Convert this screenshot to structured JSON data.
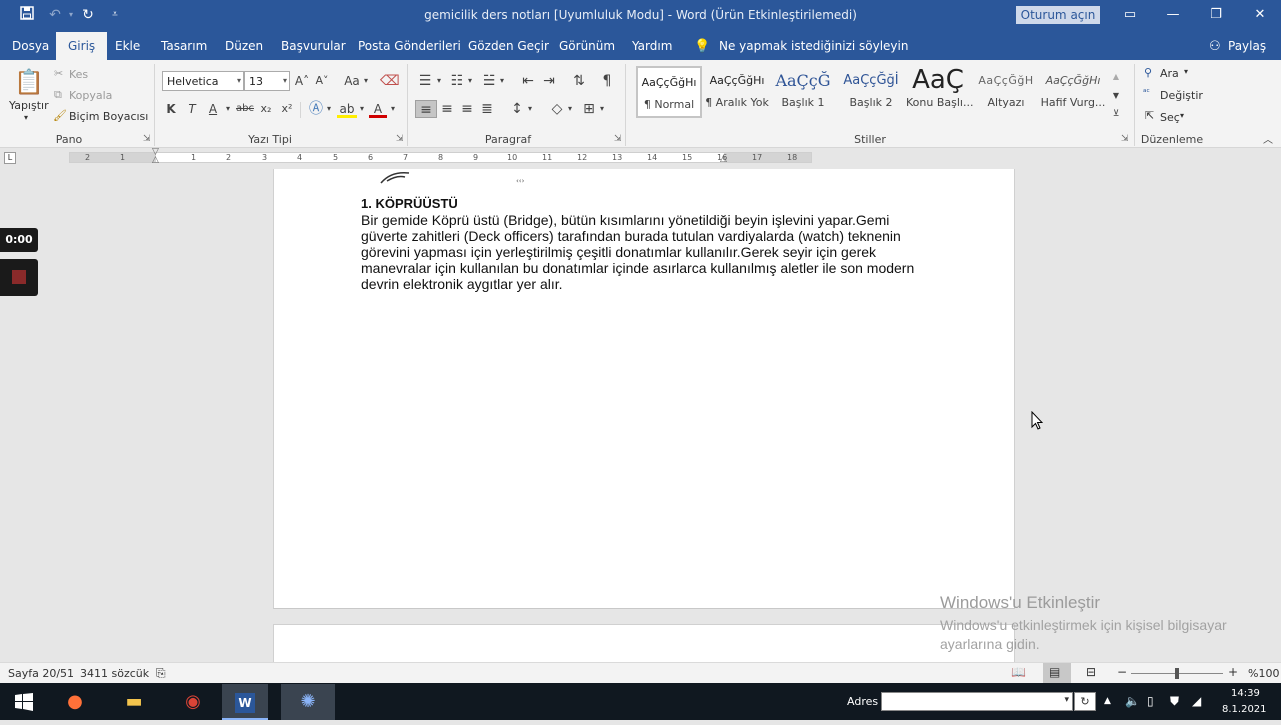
{
  "titlebar": {
    "title": "gemicilik ders notları [Uyumluluk Modu]  -  Word (Ürün Etkinleştirilemedi)",
    "signin_label": "Oturum açın",
    "save_icon": "save-icon",
    "undo_icon": "undo-icon",
    "redo_icon": "redo-icon",
    "customize_icon": "customize-quick-access-icon"
  },
  "tabs": [
    {
      "label": "Dosya"
    },
    {
      "label": "Giriş"
    },
    {
      "label": "Ekle"
    },
    {
      "label": "Tasarım"
    },
    {
      "label": "Düzen"
    },
    {
      "label": "Başvurular"
    },
    {
      "label": "Posta Gönderileri"
    },
    {
      "label": "Gözden Geçir"
    },
    {
      "label": "Görünüm"
    },
    {
      "label": "Yardım"
    }
  ],
  "tell_me": "Ne yapmak istediğinizi söyleyin",
  "share_label": "Paylaş",
  "clipboard": {
    "paste": "Yapıştır",
    "cut": "Kes",
    "copy": "Kopyala",
    "format_painter": "Biçim Boyacısı",
    "group": "Pano"
  },
  "font": {
    "name": "Helvetica",
    "size": "13",
    "group": "Yazı Tipi",
    "bold": "K",
    "italic": "T",
    "underline": "A",
    "strike": "abc",
    "sub": "x₂",
    "sup": "x²",
    "grow": "A˄",
    "shrink": "A˅",
    "case": "Aa"
  },
  "paragraph": {
    "group": "Paragraf"
  },
  "styles": {
    "group": "Stiller",
    "items": [
      {
        "preview": "AaÇçĞğHı",
        "name": "¶ Normal"
      },
      {
        "preview": "AaÇçĞğHı",
        "name": "¶ Aralık Yok"
      },
      {
        "preview": "AaÇçĞ",
        "name": "Başlık 1"
      },
      {
        "preview": "AaÇçĞğİ",
        "name": "Başlık 2"
      },
      {
        "preview": "AaÇ",
        "name": "Konu Başlı..."
      },
      {
        "preview": "AaÇçĞğH",
        "name": "Altyazı"
      },
      {
        "preview": "AaÇçĞğHı",
        "name": "Hafif Vurg..."
      }
    ]
  },
  "editing": {
    "group": "Düzenleme",
    "find": "Ara",
    "replace": "Değiştir",
    "select": "Seç"
  },
  "ruler": {
    "numbers": [
      "2",
      "1",
      "1",
      "2",
      "3",
      "4",
      "5",
      "6",
      "7",
      "8",
      "9",
      "10",
      "11",
      "12",
      "13",
      "14",
      "15",
      "16",
      "17",
      "18"
    ]
  },
  "document": {
    "heading": "1. KÖPRÜÜSTÜ",
    "lines": [
      "Bir gemide Köprü üstü (Bridge), bütün kısımlarını yönetildiği beyin işlevini yapar.Gemi",
      "güverte zahitleri (Deck officers) tarafından burada tutulan vardiyalarda (watch) teknenin",
      "görevini yapması için yerleştirilmiş çeşitli donatımlar kullanılır.Gerek seyir için gerek",
      "manevralar için kullanılan bu donatımlar içinde asırlarca kullanılmış aletler ile son modern",
      "devrin elektronik aygıtlar yer alır."
    ]
  },
  "watermark": {
    "line1": "Windows'u Etkinleştir",
    "line2": "Windows'u etkinleştirmek için kişisel bilgisayar ayarlarına gidin."
  },
  "statusbar": {
    "page": "Sayfa 20/51",
    "words": "3411 sözcük",
    "zoom": "%100"
  },
  "recorder": {
    "time": "0:00"
  },
  "taskbar": {
    "address_label": "Adres",
    "time": "14:39",
    "date": "8.1.2021"
  }
}
